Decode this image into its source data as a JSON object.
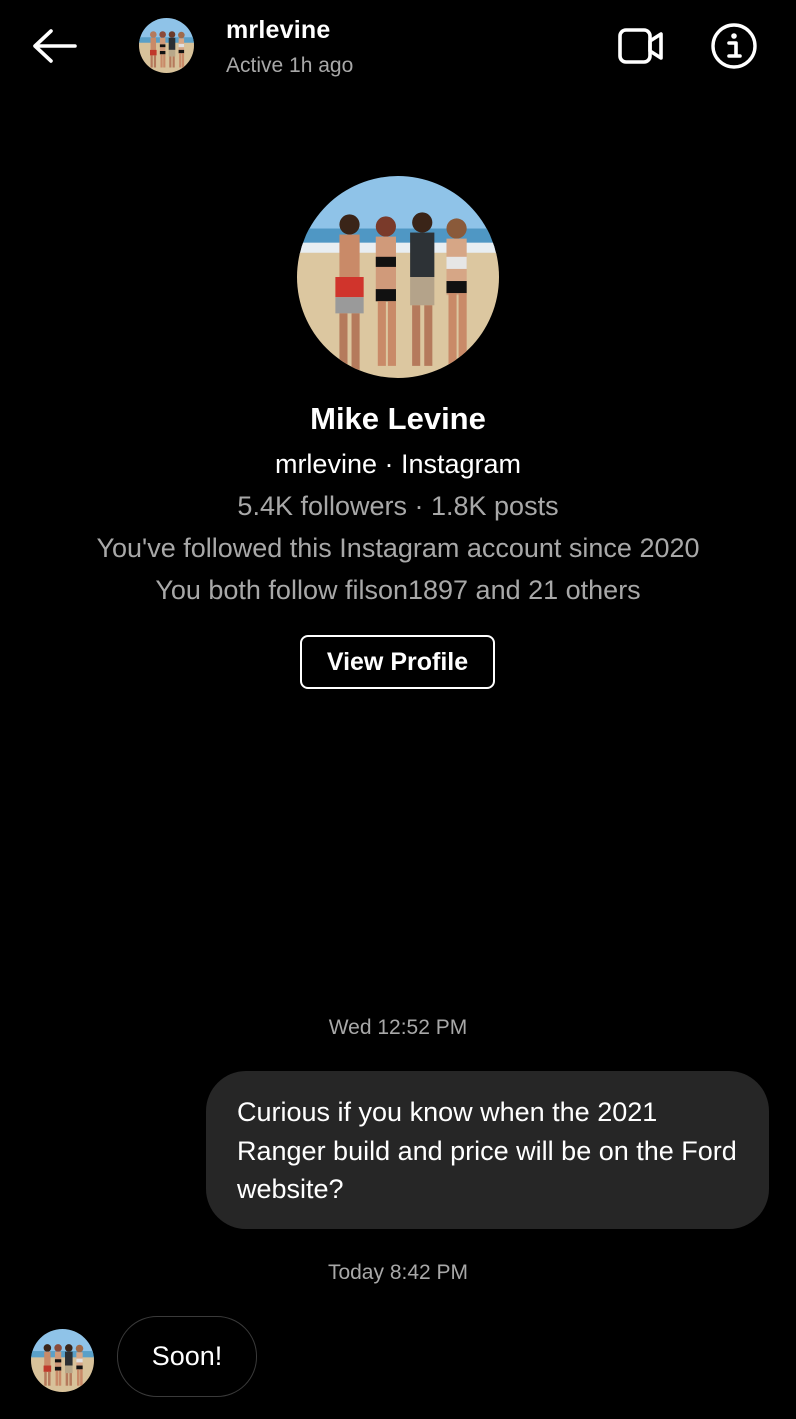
{
  "header": {
    "back_icon": "arrow-left-icon",
    "username": "mrlevine",
    "status": "Active 1h ago",
    "video_icon": "video-camera-icon",
    "info_icon": "info-icon"
  },
  "profile": {
    "full_name": "Mike Levine",
    "handle_line": "mrlevine · Instagram",
    "stats_line": "5.4K followers · 1.8K posts",
    "since_line": "You've followed this Instagram account since 2020",
    "mutual_line": "You both follow filson1897 and 21 others",
    "view_profile_label": "View Profile"
  },
  "messages": [
    {
      "type": "timestamp",
      "text": "Wed 12:52 PM"
    },
    {
      "type": "outgoing",
      "text": "Curious if you know when the 2021 Ranger build and price will be on the Ford website?"
    },
    {
      "type": "timestamp",
      "text": "Today 8:42 PM"
    },
    {
      "type": "incoming",
      "text": "Soon!"
    }
  ],
  "colors": {
    "background": "#000000",
    "primary_text": "#ffffff",
    "secondary_text": "#a8a8a8",
    "outgoing_bubble": "#262626"
  }
}
